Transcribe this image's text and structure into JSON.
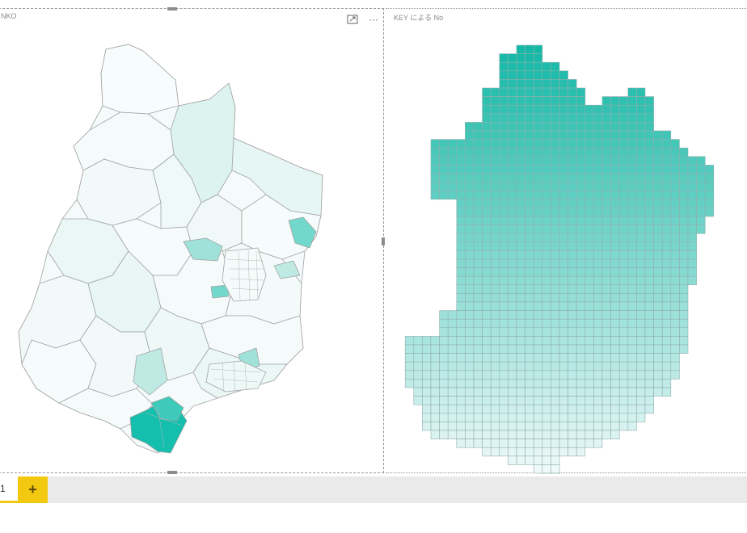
{
  "left_visual": {
    "title": "NKO",
    "focus_icon": "focus-mode-icon",
    "more_icon": "more-options-icon",
    "more_glyph": "···",
    "palette": {
      "low": "#f4fbfa",
      "mid": "#bfe9e3",
      "high": "#73d8cc",
      "max": "#14bfae",
      "border": "#9a9a9a"
    }
  },
  "right_visual": {
    "title": "KEY による No",
    "palette": {
      "top": "#14b8a6",
      "bottom": "#f2fafa",
      "grid": "#8fb0ad"
    }
  },
  "tabbar": {
    "page_label": "1",
    "add_label": "+"
  }
}
